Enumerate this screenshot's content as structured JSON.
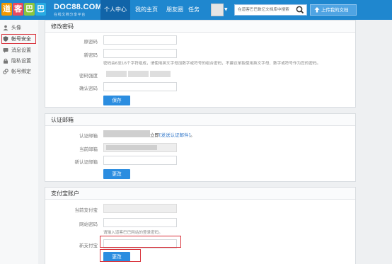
{
  "header": {
    "brand": "DOC88.COM",
    "slogan": "在线文档分享平台",
    "nav": [
      {
        "label": "个人中心",
        "active": true
      },
      {
        "label": "我的主页",
        "active": false
      },
      {
        "label": "朋友圈",
        "active": false
      },
      {
        "label": "任务",
        "active": false
      }
    ],
    "search_placeholder": "在道客巴巴数亿文档库中搜索",
    "upload_label": "上传我的文档"
  },
  "sidebar": {
    "items": [
      {
        "label": "头像",
        "icon": "user-icon"
      },
      {
        "label": "帐号安全",
        "icon": "shield-icon",
        "active": true
      },
      {
        "label": "消息设置",
        "icon": "message-icon"
      },
      {
        "label": "隐私设置",
        "icon": "lock-icon"
      },
      {
        "label": "帐号绑定",
        "icon": "link-icon"
      }
    ]
  },
  "password_panel": {
    "title": "修改密码",
    "old_label": "原密码",
    "new_label": "新密码",
    "hint": "密码由6至16个字符组成，请使用英文字母加数字或符号的组合密码，不建议单独使用英文字母、数字或符号作为您的密码。",
    "strength_label": "密码强度",
    "confirm_label": "确认密码",
    "save_label": "保存"
  },
  "email_panel": {
    "title": "认证邮箱",
    "auth_label": "认证邮箱",
    "status": "立即",
    "resend_link": "[发送认证邮件]",
    "status_end": "。",
    "current_label": "当前邮箱",
    "new_label": "新认证邮箱",
    "change_label": "更改"
  },
  "alipay_panel": {
    "title": "支付宝账户",
    "current_label": "当前支付宝",
    "site_password_label": "网站密码",
    "hint": "请输入道客巴巴网站的登录密码。",
    "new_label": "新支付宝",
    "change_label": "更改"
  },
  "colors": {
    "topbar": "#1f87cf",
    "primary_button": "#2b8de0",
    "highlight": "#d9333c"
  }
}
